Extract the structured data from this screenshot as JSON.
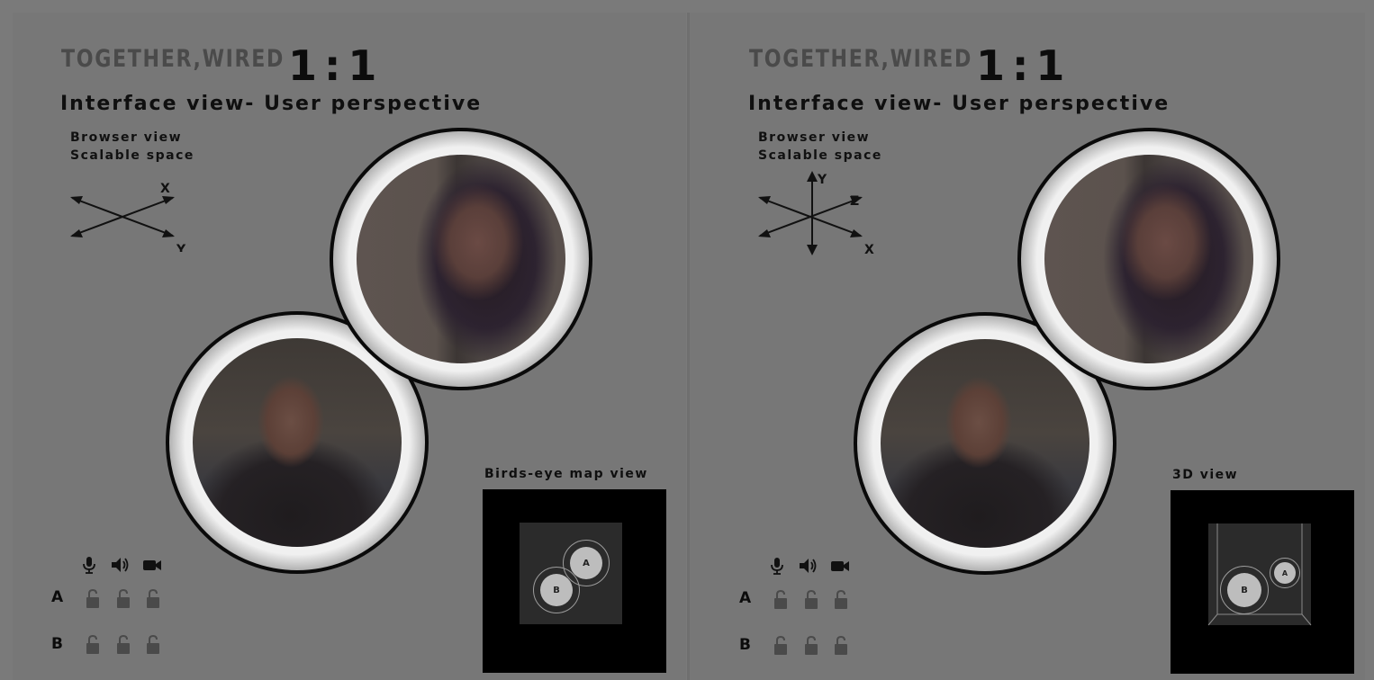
{
  "left": {
    "brand": "TOGETHER,WIRED",
    "ratio": "1:1",
    "subtitle": "Interface view- User perspective",
    "browser_label_1": "Browser view",
    "browser_label_2": "Scalable space",
    "axis_x": "X",
    "axis_y": "Y",
    "map_title": "Birds-eye map view",
    "token_a": "A",
    "token_b": "B",
    "row_a": "A",
    "row_b": "B"
  },
  "right": {
    "brand": "TOGETHER,WIRED",
    "ratio": "1:1",
    "subtitle": "Interface view- User perspective",
    "browser_label_1": "Browser view",
    "browser_label_2": "Scalable space",
    "axis_x": "X",
    "axis_y": "Y",
    "axis_z": "Z",
    "map_title": "3D view",
    "token_a": "A",
    "token_b": "B",
    "row_a": "A",
    "row_b": "B"
  },
  "icons": [
    "microphone-icon",
    "speaker-icon",
    "camera-icon",
    "unlock-icon"
  ],
  "colors": {
    "background": "#777777",
    "map": "#000000",
    "map_inner": "#2b2b2b",
    "token": "#bdbdbd"
  }
}
